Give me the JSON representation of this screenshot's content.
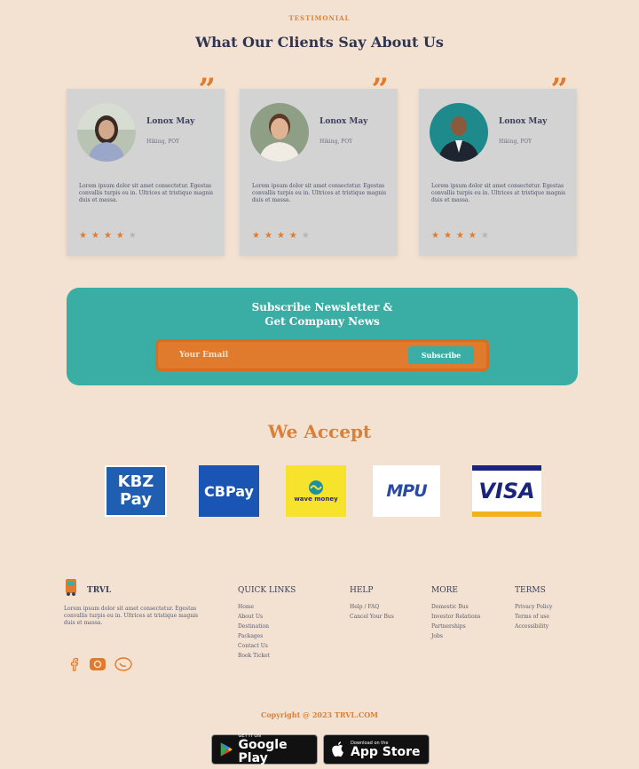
{
  "testimonials": {
    "kicker": "TESTIMONIAL",
    "title": "What Our Clients Say About Us",
    "quote_glyph": "”",
    "cards": [
      {
        "name": "Lonox May",
        "role": "Hiking, POY",
        "text": "Lorem ipsum dolor sit amet consectetur. Egestas convallis turpis eu in. Ultrices at tristique magnis duis et massa.",
        "rating": 4,
        "star_glyph": "★"
      },
      {
        "name": "Lonox May",
        "role": "Hiking, POY",
        "text": "Lorem ipsum dolor sit amet consectetur. Egestas convallis turpis eu in. Ultrices at tristique magnis duis et massa.",
        "rating": 4,
        "star_glyph": "★"
      },
      {
        "name": "Lonox May",
        "role": "Hiking, POY",
        "text": "Lorem ipsum dolor sit amet consectetur. Egestas convallis turpis eu in. Ultrices at tristique magnis duis et massa.",
        "rating": 4,
        "star_glyph": "★"
      }
    ]
  },
  "newsletter": {
    "title_line1": "Subscribe Newsletter &",
    "title_line2": "Get Company News",
    "email_placeholder": "Your Email",
    "button_label": "Subscribe"
  },
  "payments": {
    "title": "We Accept",
    "kbz_line1": "KBZ",
    "kbz_line2": "Pay",
    "cbpay": "CBPay",
    "wave": "wave money",
    "mpu": "MPU",
    "visa": "VISA"
  },
  "footer": {
    "brand": "TRVL",
    "brand_text": "Lorem ipsum dolor sit amet consectetur. Egestas convallis turpis eu in. Ultrices at tristique magnis duis et massa.",
    "quick_links": {
      "title": "QUICK LINKS",
      "items": [
        "Home",
        "About Us",
        "Destination",
        "Packages",
        "Contact Us",
        "Book Ticket"
      ]
    },
    "help": {
      "title": "HELP",
      "items": [
        "Help / FAQ",
        "Cancel Your Bus"
      ]
    },
    "more": {
      "title": "MORE",
      "items": [
        "Domestic Bus",
        "Investor Relations",
        "Partnerships",
        "Jobs"
      ]
    },
    "terms": {
      "title": "TERMS",
      "items": [
        "Privacy Policy",
        "Terms of use",
        "Accessibility"
      ]
    },
    "copyright": "Copyright @ 2023 TRVL.COM",
    "google_small": "GET IT ON",
    "google_big": "Google Play",
    "apple_small": "Download on the",
    "apple_big": "App Store"
  }
}
